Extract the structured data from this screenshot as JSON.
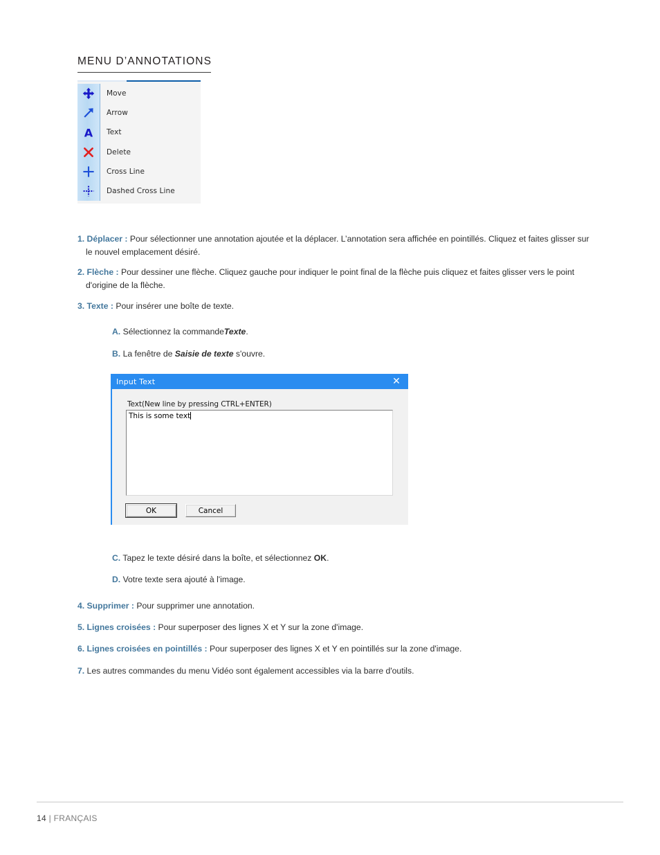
{
  "page": {
    "heading": "MENU D’ANNOTATIONS",
    "footer_page_number": "14",
    "footer_separator": "|",
    "footer_language": "FRANÇAIS"
  },
  "colors": {
    "heading_blue": "#44789d",
    "menu_accent_dark": "#0b5ca8",
    "menu_accent_light": "#dde8f5",
    "dialog_titlebar": "#2a8cf0",
    "icon_blue": "#1818c8",
    "icon_red": "#e02020"
  },
  "annotation_menu": {
    "items": [
      {
        "icon": "move-icon",
        "label": "Move"
      },
      {
        "icon": "arrow-icon",
        "label": "Arrow"
      },
      {
        "icon": "text-icon",
        "label": "Text"
      },
      {
        "icon": "delete-icon",
        "label": "Delete"
      },
      {
        "icon": "cross-line-icon",
        "label": "Cross Line"
      },
      {
        "icon": "dashed-cross-line-icon",
        "label": "Dashed Cross Line"
      }
    ]
  },
  "instructions": [
    {
      "lead": "1. Déplacer :",
      "body": " Pour sélectionner une annotation ajoutée et la déplacer. L’annotation sera affichée en pointillés. Cliquez et faites glisser sur le nouvel emplacement désiré."
    },
    {
      "lead": "2. Flèche :",
      "body": " Pour dessiner une flèche. Cliquez gauche pour indiquer le point final de la flèche puis cliquez et faites glisser vers le point d'origine de la flèche."
    },
    {
      "lead": "3. Texte :",
      "body": " Pour insérer une boîte de texte."
    }
  ],
  "sub_steps_top": [
    {
      "lead": "A.",
      "text_before": " Sélectionnez la commande",
      "emphasis": "Texte",
      "text_after": "."
    },
    {
      "lead": "B.",
      "text_before": " La fenêtre de ",
      "emphasis": "Saisie de texte",
      "text_after": " s'ouvre."
    }
  ],
  "sub_steps_bottom": [
    {
      "lead": "C.",
      "text_before": " Tapez le texte désiré dans la boîte, et sélectionnez ",
      "emphasis": "OK",
      "text_after": "."
    },
    {
      "lead": "D.",
      "text_before": " Votre texte sera ajouté à l'image.",
      "emphasis": "",
      "text_after": ""
    }
  ],
  "instructions_tail": [
    {
      "lead": "4. Supprimer :",
      "body": " Pour supprimer une annotation."
    },
    {
      "lead": "5. Lignes croisées :",
      "body": " Pour superposer des lignes X et Y sur la zone d'image."
    },
    {
      "lead": "6. Lignes croisées en pointillés :",
      "body": " Pour superposer des lignes X et Y en pointillés sur la zone d'image."
    },
    {
      "lead": "7.",
      "body": " Les autres commandes du menu Vidéo sont également accessibles via la barre d'outils."
    }
  ],
  "dialog": {
    "title": "Input Text",
    "close_icon": "✕",
    "field_label": "Text(New line by pressing CTRL+ENTER)",
    "textarea_value": "This is some text",
    "textarea_placeholder": "",
    "buttons": {
      "ok": "OK",
      "cancel": "Cancel"
    }
  }
}
